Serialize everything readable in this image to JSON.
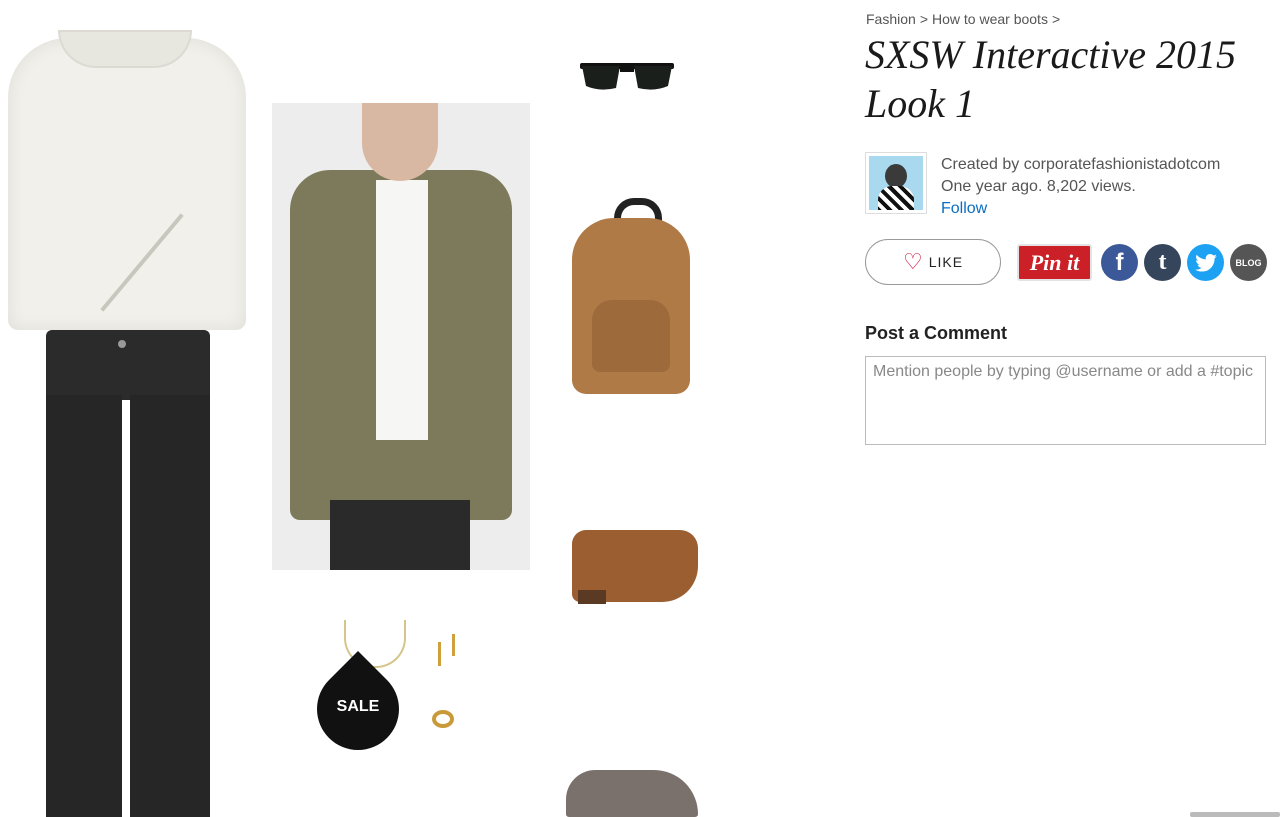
{
  "breadcrumb": {
    "items": [
      "Fashion",
      "How to wear boots"
    ],
    "separator": ">"
  },
  "set": {
    "title": "SXSW Interactive 2015 Look 1"
  },
  "creator": {
    "created_by": "Created by corporatefashionistadotcom",
    "meta": "One year ago. 8,202 views.",
    "follow_label": "Follow"
  },
  "actions": {
    "like_label": "LIKE",
    "pinterest_label": "Pin it",
    "facebook_glyph": "f",
    "tumblr_glyph": "t",
    "twitter_glyph": "—",
    "blog_label": "BLOG"
  },
  "comment": {
    "heading": "Post a Comment",
    "placeholder": "Mention people by typing @username or add a #topic"
  },
  "collage": {
    "sale_badge": "SALE"
  },
  "colors": {
    "link": "#0a6ec2",
    "pinterest": "#cb2027",
    "facebook": "#3b5998",
    "tumblr": "#35465c",
    "twitter": "#1da1f2",
    "like_heart": "#d0103a"
  }
}
